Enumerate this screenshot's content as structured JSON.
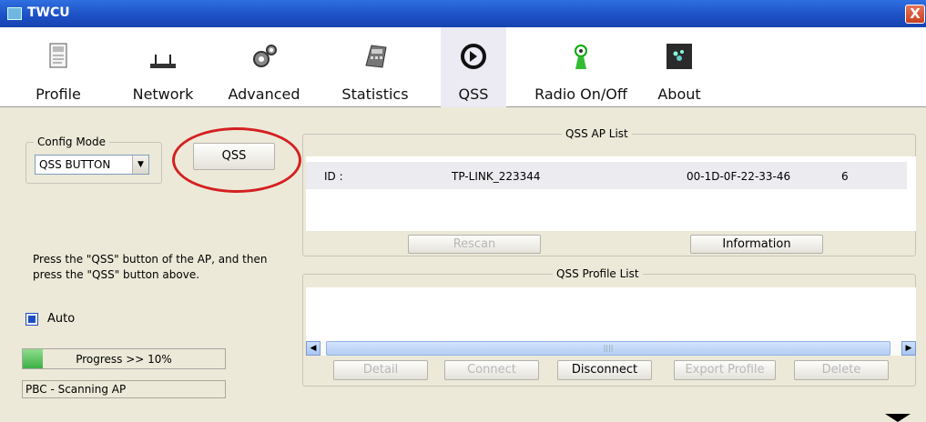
{
  "window": {
    "title": "TWCU",
    "close_label": "X"
  },
  "toolbar": {
    "items": [
      {
        "label": "Profile",
        "icon": "profile-icon"
      },
      {
        "label": "Network",
        "icon": "network-icon"
      },
      {
        "label": "Advanced",
        "icon": "advanced-icon"
      },
      {
        "label": "Statistics",
        "icon": "statistics-icon"
      },
      {
        "label": "QSS",
        "icon": "qss-icon"
      },
      {
        "label": "Radio On/Off",
        "icon": "radio-icon"
      },
      {
        "label": "About",
        "icon": "about-icon"
      }
    ],
    "active": "QSS"
  },
  "config_mode": {
    "legend": "Config Mode",
    "selected": "QSS BUTTON",
    "qss_button_label": "QSS"
  },
  "qss_ap_list": {
    "legend": "QSS AP List",
    "rows": [
      {
        "id_label": "ID :",
        "ssid": "TP-LINK_223344",
        "bssid": "00-1D-0F-22-33-46",
        "channel": "6"
      }
    ],
    "rescan_label": "Rescan",
    "information_label": "Information"
  },
  "hint_text": "Press the \"QSS\" button of the AP, and then press the \"QSS\" button above.",
  "auto_label": "Auto",
  "progress": {
    "text": "Progress >> 10%",
    "value": 0.1
  },
  "status_text": "PBC - Scanning AP",
  "qss_profile_list": {
    "legend": "QSS Profile List",
    "scroll_grip": "||||",
    "buttons": {
      "detail": "Detail",
      "connect": "Connect",
      "disconnect": "Disconnect",
      "export_profile": "Export Profile",
      "delete": "Delete"
    }
  },
  "colors": {
    "accent": "#1c4fc4",
    "highlight_circle": "#d42020",
    "progress_fill": "#3cb045"
  }
}
